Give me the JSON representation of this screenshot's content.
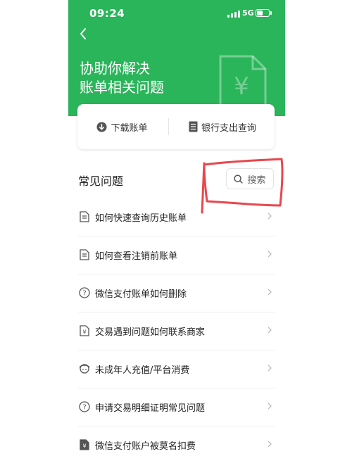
{
  "status_bar": {
    "time": "09:24",
    "network": "5G"
  },
  "header": {
    "title_line1": "协助你解决",
    "title_line2": "账单相关问题"
  },
  "actions": {
    "download_label": "下载账单",
    "bank_query_label": "银行支出查询"
  },
  "faq_section": {
    "title": "常见问题",
    "search_placeholder": "搜索",
    "items": [
      {
        "label": "如何快速查询历史账单",
        "icon": "document-icon"
      },
      {
        "label": "如何查看注销前账单",
        "icon": "document-icon"
      },
      {
        "label": "微信支付账单如何删除",
        "icon": "question-circle-icon"
      },
      {
        "label": "交易遇到问题如何联系商家",
        "icon": "yuan-document-icon"
      },
      {
        "label": "未成年人充值/平台消费",
        "icon": "child-icon"
      },
      {
        "label": "申请交易明细证明常见问题",
        "icon": "question-circle-icon"
      },
      {
        "label": "微信支付账户被莫名扣费",
        "icon": "yuan-document-icon"
      }
    ]
  },
  "colors": {
    "brand_green": "#2bb55b",
    "annotation_red": "#e8474d"
  }
}
